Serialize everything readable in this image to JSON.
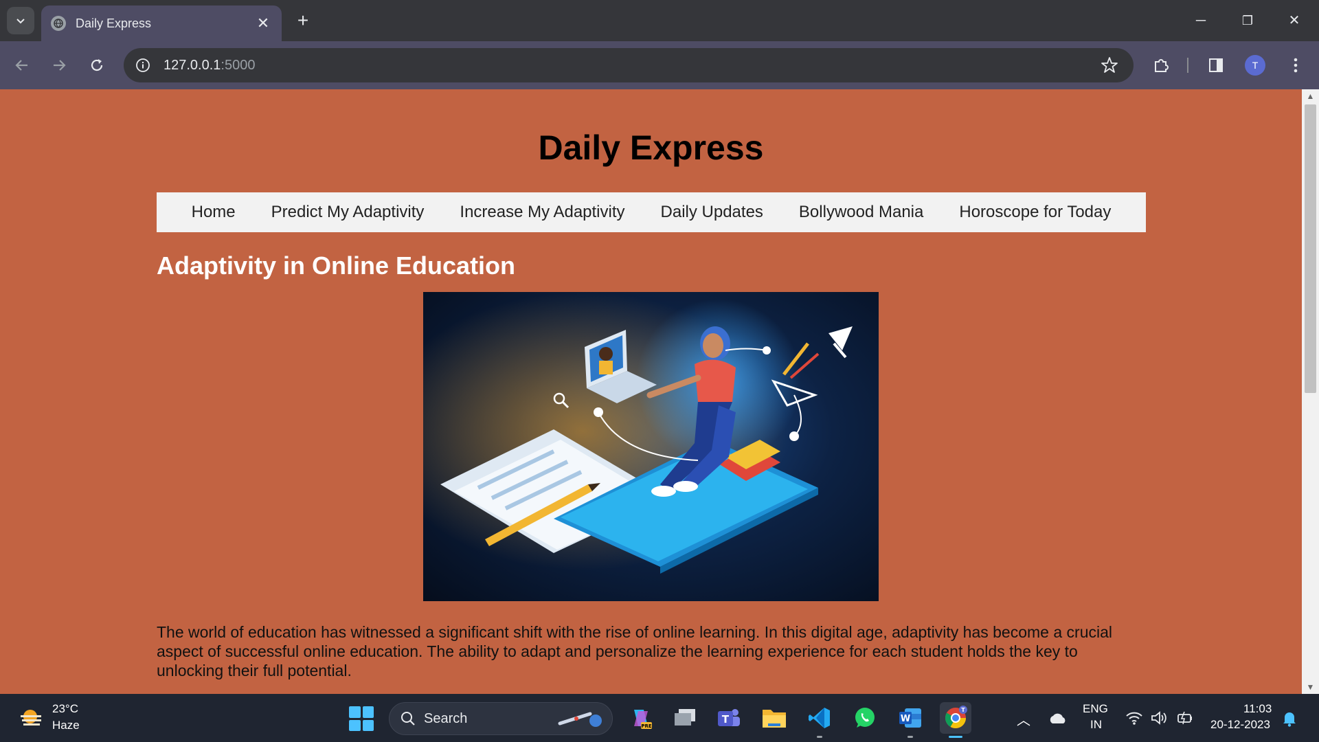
{
  "browser": {
    "tab_title": "Daily Express",
    "url_host": "127.0.0.1",
    "url_port": ":5000",
    "profile_initial": "T",
    "window_controls": {
      "minimize": "─",
      "maximize": "❐",
      "close": "✕"
    },
    "tab_close": "✕",
    "new_tab": "+"
  },
  "page": {
    "site_title": "Daily Express",
    "nav": [
      "Home",
      "Predict My Adaptivity",
      "Increase My Adaptivity",
      "Daily Updates",
      "Bollywood Mania",
      "Horoscope for Today"
    ],
    "heading": "Adaptivity in Online Education",
    "body": "The world of education has witnessed a significant shift with the rise of online learning. In this digital age, adaptivity has become a crucial aspect of successful online education. The ability to adapt and personalize the learning experience for each student holds the key to unlocking their full potential.",
    "background_color": "#c26342",
    "nav_background": "#f2f2f2"
  },
  "taskbar": {
    "weather_temp": "23°C",
    "weather_condition": "Haze",
    "search_label": "Search",
    "language_primary": "ENG",
    "language_secondary": "IN",
    "time": "11:03",
    "date": "20-12-2023",
    "apps": [
      "copilot-icon",
      "task-view-icon",
      "teams-icon",
      "file-explorer-icon",
      "vscode-icon",
      "whatsapp-icon",
      "word-icon",
      "chrome-icon"
    ]
  }
}
